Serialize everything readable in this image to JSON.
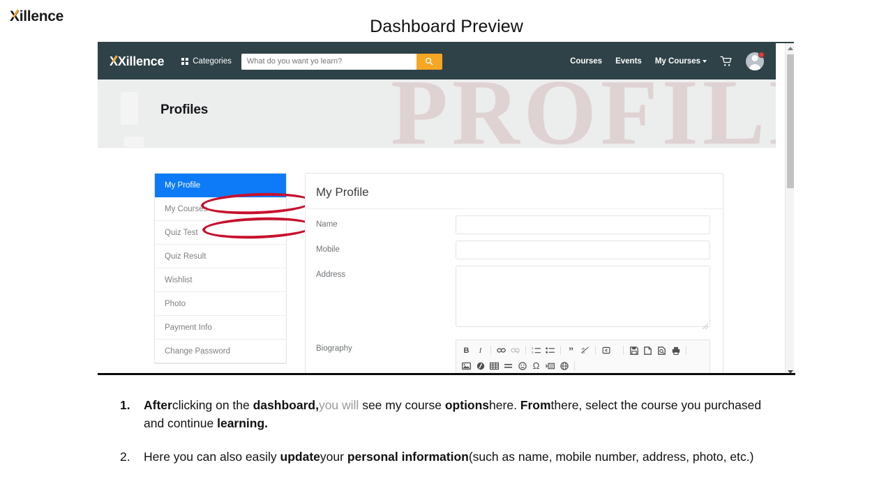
{
  "slide": {
    "brand": "Xillence",
    "title": "Dashboard Preview"
  },
  "screenshot": {
    "navbar": {
      "logo": "Xillence",
      "categories_label": "Categories",
      "search": {
        "placeholder": "What do you want yo learn?",
        "value": "",
        "button_icon": "search-icon"
      },
      "links": [
        {
          "label": "Courses"
        },
        {
          "label": "Events"
        },
        {
          "label": "My Courses",
          "has_caret": true
        }
      ],
      "cart_icon": "cart-icon",
      "avatar_icon": "user-avatar-icon",
      "notification_badge": ""
    },
    "hero": {
      "title": "Profiles",
      "watermark": "PROFILE"
    },
    "sidebar": {
      "items": [
        {
          "label": "My Profile",
          "active": true
        },
        {
          "label": "My Courses",
          "active": false
        },
        {
          "label": "Quiz Test",
          "active": false
        },
        {
          "label": "Quiz Result",
          "active": false
        },
        {
          "label": "Wishlist",
          "active": false
        },
        {
          "label": "Photo",
          "active": false
        },
        {
          "label": "Payment Info",
          "active": false
        },
        {
          "label": "Change Password",
          "active": false
        }
      ]
    },
    "profile_card": {
      "title": "My Profile",
      "fields": [
        {
          "label": "Name",
          "type": "text",
          "value": ""
        },
        {
          "label": "Mobile",
          "type": "text",
          "value": ""
        },
        {
          "label": "Address",
          "type": "textarea",
          "value": ""
        },
        {
          "label": "Biography",
          "type": "richtext",
          "value": ""
        }
      ],
      "editor_toolbar": {
        "row1": [
          {
            "icon": "bold-icon",
            "glyph": "B",
            "dim": false
          },
          {
            "icon": "italic-icon",
            "glyph": "I",
            "dim": false
          },
          {
            "sep": true
          },
          {
            "icon": "link-icon",
            "glyph": "⚭",
            "dim": false
          },
          {
            "icon": "unlink-icon",
            "glyph": "⚭",
            "dim": true
          },
          {
            "sep": true
          },
          {
            "icon": "numbered-list-icon",
            "glyph": "☰",
            "dim": false
          },
          {
            "icon": "bulleted-list-icon",
            "glyph": "≡",
            "dim": false
          },
          {
            "sep": true
          },
          {
            "icon": "blockquote-icon",
            "glyph": "”",
            "dim": false
          },
          {
            "icon": "special-format-icon",
            "glyph": "⌗",
            "dim": false
          },
          {
            "sep": true
          },
          {
            "icon": "source-icon",
            "glyph": "▣",
            "label": "Source",
            "dim": false
          },
          {
            "sep": true
          },
          {
            "icon": "save-icon",
            "glyph": "💾",
            "dim": false
          },
          {
            "icon": "new-page-icon",
            "glyph": "⬚",
            "dim": false
          },
          {
            "icon": "preview-icon",
            "glyph": "⬚",
            "dim": false
          },
          {
            "icon": "print-icon",
            "glyph": "⎙",
            "dim": false
          },
          {
            "sep": true
          }
        ],
        "row2": [
          {
            "icon": "image-icon",
            "glyph": "ὛC",
            "dim": false
          },
          {
            "icon": "flash-icon",
            "glyph": "◐",
            "dim": false
          },
          {
            "icon": "table-icon",
            "glyph": "⊞",
            "dim": false
          },
          {
            "icon": "horizontal-rule-icon",
            "glyph": "≡",
            "dim": false
          },
          {
            "icon": "smiley-icon",
            "glyph": "☺",
            "dim": false
          },
          {
            "icon": "special-char-icon",
            "glyph": "Ω",
            "dim": false
          },
          {
            "icon": "page-break-icon",
            "glyph": "⇥",
            "dim": false
          },
          {
            "icon": "iframe-icon",
            "glyph": "⊕",
            "dim": false
          },
          {
            "sep": true
          }
        ]
      }
    },
    "scrollbar": {
      "up_icon": "scroll-up-arrow-icon",
      "down_icon": "scroll-down-arrow-icon"
    },
    "annotations": [
      {
        "name": "ellipse-my-profile",
        "color": "#c8102e"
      },
      {
        "name": "ellipse-my-courses",
        "color": "#c8102e"
      }
    ]
  },
  "notes": [
    {
      "number": "1.",
      "number_bold": true,
      "parts": [
        {
          "t": "After",
          "b": true
        },
        {
          "t": "clicking on the ",
          "b": false
        },
        {
          "t": "dashboard,",
          "b": true
        },
        {
          "t": "you will",
          "b": false,
          "faded": true
        },
        {
          "t": " see my course ",
          "b": false
        },
        {
          "t": "options",
          "b": true
        },
        {
          "t": "here. ",
          "b": false
        },
        {
          "t": "From",
          "b": true
        },
        {
          "t": "there, select the course you purchased and continue ",
          "b": false
        },
        {
          "t": "learning.",
          "b": true
        }
      ]
    },
    {
      "number": "2.",
      "number_bold": false,
      "parts": [
        {
          "t": "Here you can also easily ",
          "b": false
        },
        {
          "t": "update",
          "b": true
        },
        {
          "t": "your ",
          "b": false
        },
        {
          "t": "personal information",
          "b": true
        },
        {
          "t": "(such as name, mobile number, address, photo, etc.)",
          "b": false
        }
      ]
    }
  ]
}
